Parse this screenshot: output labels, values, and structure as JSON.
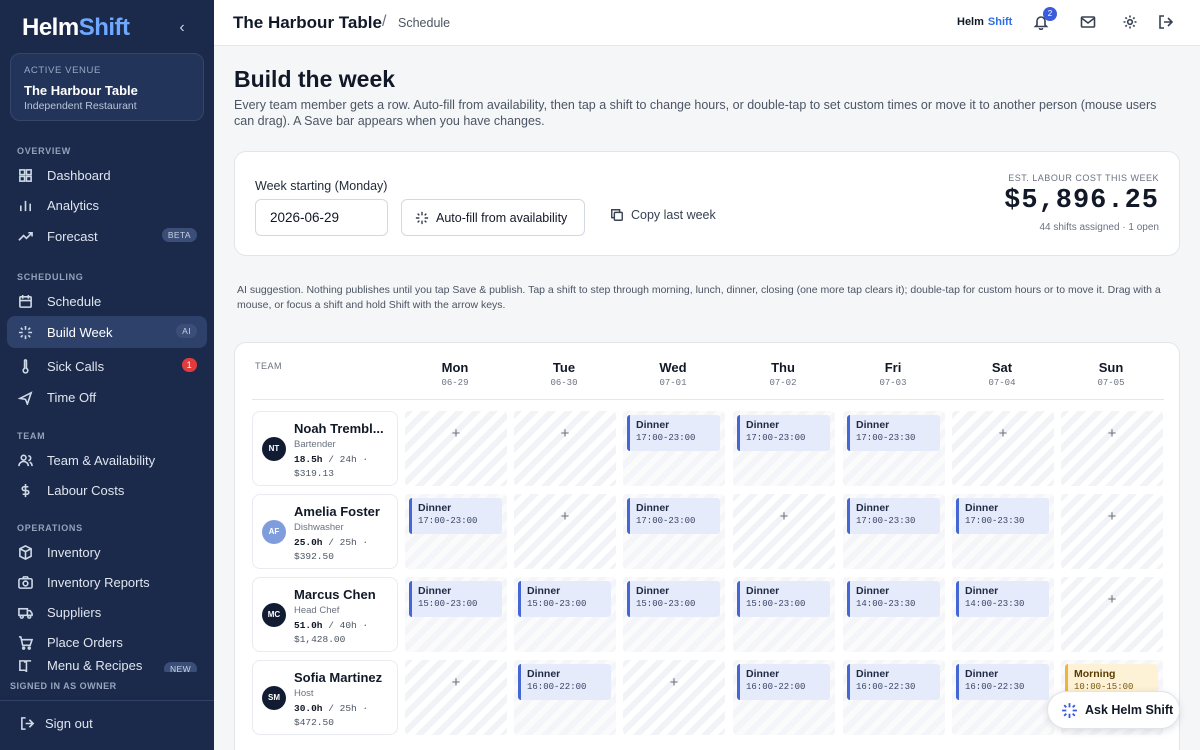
{
  "brand": {
    "word1": "Helm",
    "word2": "Shift"
  },
  "venue": {
    "label": "ACTIVE VENUE",
    "name": "The Harbour Table",
    "type": "Independent Restaurant"
  },
  "sections": {
    "overview": "OVERVIEW",
    "scheduling": "SCHEDULING",
    "team": "TEAM",
    "operations": "OPERATIONS"
  },
  "nav": {
    "dashboard": "Dashboard",
    "analytics": "Analytics",
    "forecast": "Forecast",
    "forecast_badge": "BETA",
    "schedule": "Schedule",
    "build_week": "Build Week",
    "build_week_badge": "AI",
    "sick_calls": "Sick Calls",
    "sick_calls_count": "1",
    "time_off": "Time Off",
    "team_availability": "Team & Availability",
    "labour_costs": "Labour Costs",
    "inventory": "Inventory",
    "inventory_reports": "Inventory Reports",
    "suppliers": "Suppliers",
    "place_orders": "Place Orders",
    "menu_recipes": "Menu & Recipes",
    "menu_badge": "NEW"
  },
  "signed_in": "SIGNED IN AS OWNER",
  "sign_out": "Sign out",
  "topbar": {
    "venue": "The Harbour Table",
    "sep": "/",
    "page": "Schedule",
    "notif_count": "2"
  },
  "page": {
    "title": "Build the week",
    "description": "Every team member gets a row. Auto-fill from availability, then tap a shift to change hours, or double-tap to set custom times or move it to another person (mouse users can drag). A Save bar appears when you have changes."
  },
  "controls": {
    "week_label": "Week starting (Monday)",
    "week_value": "2026-06-29",
    "autofill": "Auto-fill from availability",
    "copy": "Copy last week",
    "cost_label": "EST. LABOUR COST THIS WEEK",
    "cost_value": "$5,896.25",
    "cost_sub": "44 shifts assigned · 1 open"
  },
  "ai_note": "AI suggestion. Nothing publishes until you tap Save & publish. Tap a shift to step through morning, lunch, dinner, closing (one more tap clears it); double-tap for custom hours or to move it. Drag with a mouse, or focus a shift and hold Shift with the arrow keys.",
  "grid": {
    "team_header": "TEAM",
    "days": [
      {
        "name": "Mon",
        "date": "06-29"
      },
      {
        "name": "Tue",
        "date": "06-30"
      },
      {
        "name": "Wed",
        "date": "07-01"
      },
      {
        "name": "Thu",
        "date": "07-02"
      },
      {
        "name": "Fri",
        "date": "07-03"
      },
      {
        "name": "Sat",
        "date": "07-04"
      },
      {
        "name": "Sun",
        "date": "07-05"
      }
    ],
    "people": [
      {
        "initials": "NT",
        "name": "Noah Trembl...",
        "role": "Bartender",
        "hours": "18.5h",
        "cap": "/ 24h ·",
        "cost": "$319.13",
        "shifts": [
          null,
          null,
          {
            "name": "Dinner",
            "time": "17:00-23:00"
          },
          {
            "name": "Dinner",
            "time": "17:00-23:00"
          },
          {
            "name": "Dinner",
            "time": "17:00-23:30"
          },
          null,
          null
        ]
      },
      {
        "initials": "AF",
        "name": "Amelia Foster",
        "role": "Dishwasher",
        "hours": "25.0h",
        "cap": "/ 25h ·",
        "cost": "$392.50",
        "shifts": [
          {
            "name": "Dinner",
            "time": "17:00-23:00"
          },
          null,
          {
            "name": "Dinner",
            "time": "17:00-23:00"
          },
          null,
          {
            "name": "Dinner",
            "time": "17:00-23:30"
          },
          {
            "name": "Dinner",
            "time": "17:00-23:30"
          },
          null
        ]
      },
      {
        "initials": "MC",
        "name": "Marcus Chen",
        "role": "Head Chef",
        "hours": "51.0h",
        "cap": "/ 40h ·",
        "cost": "$1,428.00",
        "shifts": [
          {
            "name": "Dinner",
            "time": "15:00-23:00"
          },
          {
            "name": "Dinner",
            "time": "15:00-23:00"
          },
          {
            "name": "Dinner",
            "time": "15:00-23:00"
          },
          {
            "name": "Dinner",
            "time": "15:00-23:00"
          },
          {
            "name": "Dinner",
            "time": "14:00-23:30"
          },
          {
            "name": "Dinner",
            "time": "14:00-23:30"
          },
          null
        ]
      },
      {
        "initials": "SM",
        "name": "Sofia Martinez",
        "role": "Host",
        "hours": "30.0h",
        "cap": "/ 25h ·",
        "cost": "$472.50",
        "shifts": [
          null,
          {
            "name": "Dinner",
            "time": "16:00-22:00"
          },
          null,
          {
            "name": "Dinner",
            "time": "16:00-22:00"
          },
          {
            "name": "Dinner",
            "time": "16:00-22:30"
          },
          {
            "name": "Dinner",
            "time": "16:00-22:30"
          },
          {
            "name": "Morning",
            "time": "10:00-15:00",
            "kind": "morning"
          }
        ]
      }
    ]
  },
  "ask": "Ask Helm Shift",
  "colors": {
    "sidebar": "#1b2a4a",
    "accent": "#3b5bdb",
    "shift": "#e6ebfb",
    "morning": "#fdf1d6"
  }
}
